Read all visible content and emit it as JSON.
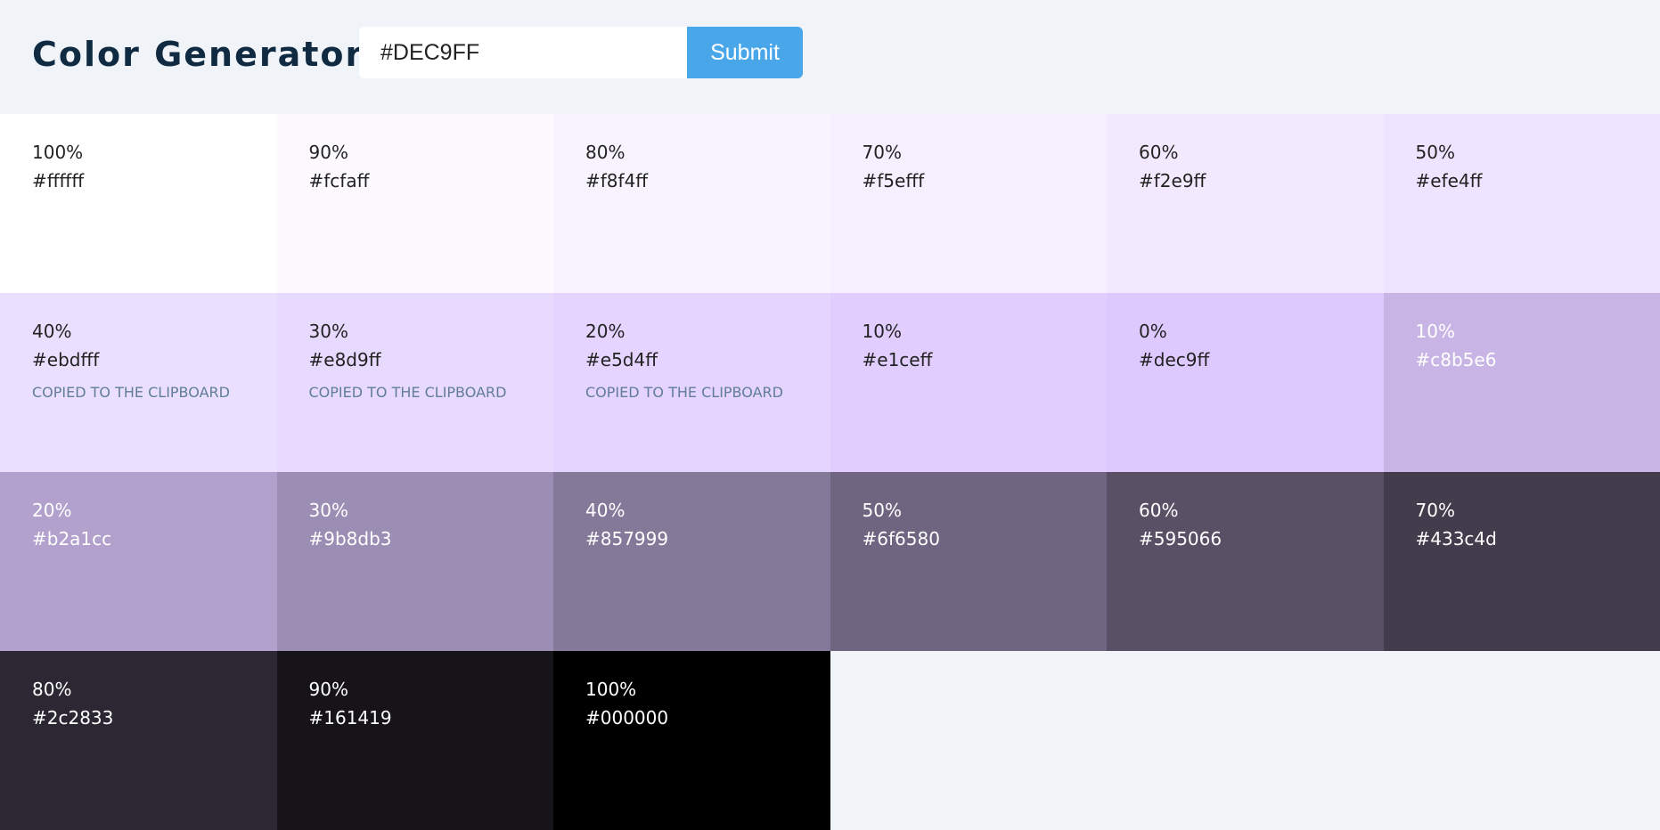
{
  "header": {
    "title": "Color Generator",
    "input_value": "#DEC9FF",
    "submit_label": "Submit"
  },
  "colors": {
    "accent": "#49a6e9",
    "title": "#102a42",
    "background": "#f0f4f8",
    "dark_text": "#222222",
    "light_text": "#ffffff",
    "copied_text": "#617d98"
  },
  "swatches": [
    {
      "percent": "100%",
      "hex": "#ffffff",
      "text": "dark"
    },
    {
      "percent": "90%",
      "hex": "#fcfaff",
      "text": "dark"
    },
    {
      "percent": "80%",
      "hex": "#f8f4ff",
      "text": "dark"
    },
    {
      "percent": "70%",
      "hex": "#f5efff",
      "text": "dark"
    },
    {
      "percent": "60%",
      "hex": "#f2e9ff",
      "text": "dark"
    },
    {
      "percent": "50%",
      "hex": "#efe4ff",
      "text": "dark"
    },
    {
      "percent": "40%",
      "hex": "#ebdfff",
      "text": "dark",
      "copied": "COPIED TO THE CLIPBOARD"
    },
    {
      "percent": "30%",
      "hex": "#e8d9ff",
      "text": "dark",
      "copied": "COPIED TO THE CLIPBOARD"
    },
    {
      "percent": "20%",
      "hex": "#e5d4ff",
      "text": "dark",
      "copied": "COPIED TO THE CLIPBOARD"
    },
    {
      "percent": "10%",
      "hex": "#e1ceff",
      "text": "dark"
    },
    {
      "percent": "0%",
      "hex": "#dec9ff",
      "text": "dark"
    },
    {
      "percent": "10%",
      "hex": "#c8b5e6",
      "text": "light"
    },
    {
      "percent": "20%",
      "hex": "#b2a1cc",
      "text": "light"
    },
    {
      "percent": "30%",
      "hex": "#9b8db3",
      "text": "light"
    },
    {
      "percent": "40%",
      "hex": "#857999",
      "text": "light"
    },
    {
      "percent": "50%",
      "hex": "#6f6580",
      "text": "light"
    },
    {
      "percent": "60%",
      "hex": "#595066",
      "text": "light"
    },
    {
      "percent": "70%",
      "hex": "#433c4d",
      "text": "light"
    },
    {
      "percent": "80%",
      "hex": "#2c2833",
      "text": "light"
    },
    {
      "percent": "90%",
      "hex": "#161419",
      "text": "light"
    },
    {
      "percent": "100%",
      "hex": "#000000",
      "text": "light"
    }
  ]
}
